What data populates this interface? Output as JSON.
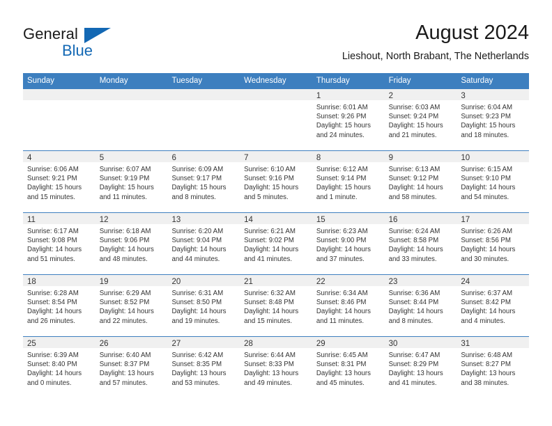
{
  "brand": {
    "name_part1": "General",
    "name_part2": "Blue",
    "logo_icon": "blue-triangle-icon",
    "accent_color": "#1368b4"
  },
  "header": {
    "title": "August 2024",
    "subtitle": "Lieshout, North Brabant, The Netherlands"
  },
  "calendar": {
    "header_color": "#3d7fbf",
    "day_band_color": "#f0f0f0",
    "weekdays": [
      "Sunday",
      "Monday",
      "Tuesday",
      "Wednesday",
      "Thursday",
      "Friday",
      "Saturday"
    ],
    "weeks": [
      [
        {
          "day": "",
          "empty": true
        },
        {
          "day": "",
          "empty": true
        },
        {
          "day": "",
          "empty": true
        },
        {
          "day": "",
          "empty": true
        },
        {
          "day": "1",
          "sunrise": "Sunrise: 6:01 AM",
          "sunset": "Sunset: 9:26 PM",
          "daylight_line1": "Daylight: 15 hours",
          "daylight_line2": "and 24 minutes."
        },
        {
          "day": "2",
          "sunrise": "Sunrise: 6:03 AM",
          "sunset": "Sunset: 9:24 PM",
          "daylight_line1": "Daylight: 15 hours",
          "daylight_line2": "and 21 minutes."
        },
        {
          "day": "3",
          "sunrise": "Sunrise: 6:04 AM",
          "sunset": "Sunset: 9:23 PM",
          "daylight_line1": "Daylight: 15 hours",
          "daylight_line2": "and 18 minutes."
        }
      ],
      [
        {
          "day": "4",
          "sunrise": "Sunrise: 6:06 AM",
          "sunset": "Sunset: 9:21 PM",
          "daylight_line1": "Daylight: 15 hours",
          "daylight_line2": "and 15 minutes."
        },
        {
          "day": "5",
          "sunrise": "Sunrise: 6:07 AM",
          "sunset": "Sunset: 9:19 PM",
          "daylight_line1": "Daylight: 15 hours",
          "daylight_line2": "and 11 minutes."
        },
        {
          "day": "6",
          "sunrise": "Sunrise: 6:09 AM",
          "sunset": "Sunset: 9:17 PM",
          "daylight_line1": "Daylight: 15 hours",
          "daylight_line2": "and 8 minutes."
        },
        {
          "day": "7",
          "sunrise": "Sunrise: 6:10 AM",
          "sunset": "Sunset: 9:16 PM",
          "daylight_line1": "Daylight: 15 hours",
          "daylight_line2": "and 5 minutes."
        },
        {
          "day": "8",
          "sunrise": "Sunrise: 6:12 AM",
          "sunset": "Sunset: 9:14 PM",
          "daylight_line1": "Daylight: 15 hours",
          "daylight_line2": "and 1 minute."
        },
        {
          "day": "9",
          "sunrise": "Sunrise: 6:13 AM",
          "sunset": "Sunset: 9:12 PM",
          "daylight_line1": "Daylight: 14 hours",
          "daylight_line2": "and 58 minutes."
        },
        {
          "day": "10",
          "sunrise": "Sunrise: 6:15 AM",
          "sunset": "Sunset: 9:10 PM",
          "daylight_line1": "Daylight: 14 hours",
          "daylight_line2": "and 54 minutes."
        }
      ],
      [
        {
          "day": "11",
          "sunrise": "Sunrise: 6:17 AM",
          "sunset": "Sunset: 9:08 PM",
          "daylight_line1": "Daylight: 14 hours",
          "daylight_line2": "and 51 minutes."
        },
        {
          "day": "12",
          "sunrise": "Sunrise: 6:18 AM",
          "sunset": "Sunset: 9:06 PM",
          "daylight_line1": "Daylight: 14 hours",
          "daylight_line2": "and 48 minutes."
        },
        {
          "day": "13",
          "sunrise": "Sunrise: 6:20 AM",
          "sunset": "Sunset: 9:04 PM",
          "daylight_line1": "Daylight: 14 hours",
          "daylight_line2": "and 44 minutes."
        },
        {
          "day": "14",
          "sunrise": "Sunrise: 6:21 AM",
          "sunset": "Sunset: 9:02 PM",
          "daylight_line1": "Daylight: 14 hours",
          "daylight_line2": "and 41 minutes."
        },
        {
          "day": "15",
          "sunrise": "Sunrise: 6:23 AM",
          "sunset": "Sunset: 9:00 PM",
          "daylight_line1": "Daylight: 14 hours",
          "daylight_line2": "and 37 minutes."
        },
        {
          "day": "16",
          "sunrise": "Sunrise: 6:24 AM",
          "sunset": "Sunset: 8:58 PM",
          "daylight_line1": "Daylight: 14 hours",
          "daylight_line2": "and 33 minutes."
        },
        {
          "day": "17",
          "sunrise": "Sunrise: 6:26 AM",
          "sunset": "Sunset: 8:56 PM",
          "daylight_line1": "Daylight: 14 hours",
          "daylight_line2": "and 30 minutes."
        }
      ],
      [
        {
          "day": "18",
          "sunrise": "Sunrise: 6:28 AM",
          "sunset": "Sunset: 8:54 PM",
          "daylight_line1": "Daylight: 14 hours",
          "daylight_line2": "and 26 minutes."
        },
        {
          "day": "19",
          "sunrise": "Sunrise: 6:29 AM",
          "sunset": "Sunset: 8:52 PM",
          "daylight_line1": "Daylight: 14 hours",
          "daylight_line2": "and 22 minutes."
        },
        {
          "day": "20",
          "sunrise": "Sunrise: 6:31 AM",
          "sunset": "Sunset: 8:50 PM",
          "daylight_line1": "Daylight: 14 hours",
          "daylight_line2": "and 19 minutes."
        },
        {
          "day": "21",
          "sunrise": "Sunrise: 6:32 AM",
          "sunset": "Sunset: 8:48 PM",
          "daylight_line1": "Daylight: 14 hours",
          "daylight_line2": "and 15 minutes."
        },
        {
          "day": "22",
          "sunrise": "Sunrise: 6:34 AM",
          "sunset": "Sunset: 8:46 PM",
          "daylight_line1": "Daylight: 14 hours",
          "daylight_line2": "and 11 minutes."
        },
        {
          "day": "23",
          "sunrise": "Sunrise: 6:36 AM",
          "sunset": "Sunset: 8:44 PM",
          "daylight_line1": "Daylight: 14 hours",
          "daylight_line2": "and 8 minutes."
        },
        {
          "day": "24",
          "sunrise": "Sunrise: 6:37 AM",
          "sunset": "Sunset: 8:42 PM",
          "daylight_line1": "Daylight: 14 hours",
          "daylight_line2": "and 4 minutes."
        }
      ],
      [
        {
          "day": "25",
          "sunrise": "Sunrise: 6:39 AM",
          "sunset": "Sunset: 8:40 PM",
          "daylight_line1": "Daylight: 14 hours",
          "daylight_line2": "and 0 minutes."
        },
        {
          "day": "26",
          "sunrise": "Sunrise: 6:40 AM",
          "sunset": "Sunset: 8:37 PM",
          "daylight_line1": "Daylight: 13 hours",
          "daylight_line2": "and 57 minutes."
        },
        {
          "day": "27",
          "sunrise": "Sunrise: 6:42 AM",
          "sunset": "Sunset: 8:35 PM",
          "daylight_line1": "Daylight: 13 hours",
          "daylight_line2": "and 53 minutes."
        },
        {
          "day": "28",
          "sunrise": "Sunrise: 6:44 AM",
          "sunset": "Sunset: 8:33 PM",
          "daylight_line1": "Daylight: 13 hours",
          "daylight_line2": "and 49 minutes."
        },
        {
          "day": "29",
          "sunrise": "Sunrise: 6:45 AM",
          "sunset": "Sunset: 8:31 PM",
          "daylight_line1": "Daylight: 13 hours",
          "daylight_line2": "and 45 minutes."
        },
        {
          "day": "30",
          "sunrise": "Sunrise: 6:47 AM",
          "sunset": "Sunset: 8:29 PM",
          "daylight_line1": "Daylight: 13 hours",
          "daylight_line2": "and 41 minutes."
        },
        {
          "day": "31",
          "sunrise": "Sunrise: 6:48 AM",
          "sunset": "Sunset: 8:27 PM",
          "daylight_line1": "Daylight: 13 hours",
          "daylight_line2": "and 38 minutes."
        }
      ]
    ]
  }
}
